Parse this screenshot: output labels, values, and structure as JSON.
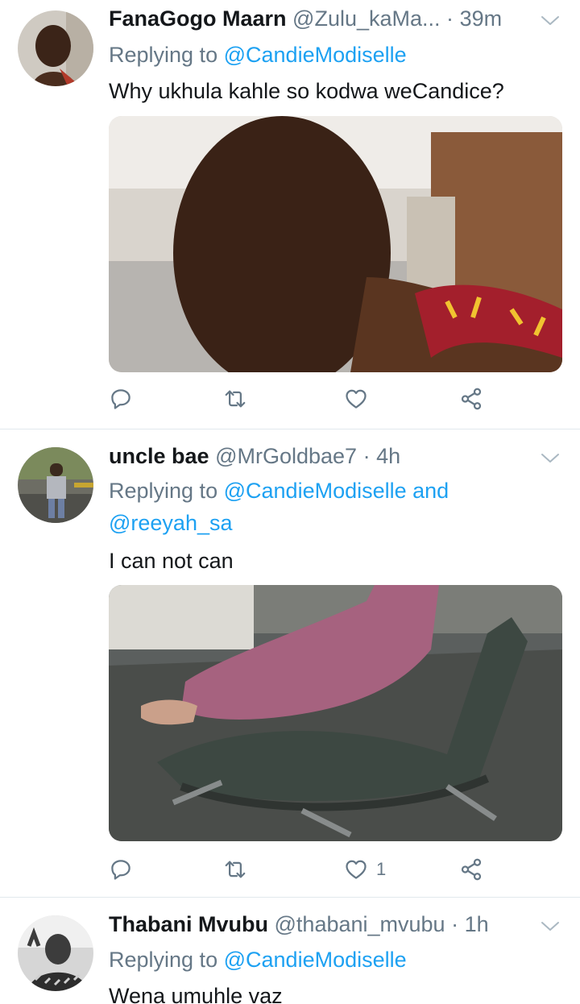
{
  "tweets": [
    {
      "name": "FanaGogo Maarn",
      "handle": "@Zulu_kaMa...",
      "time": "39m",
      "replying_label": "Replying to",
      "mentions": "@CandieModiselle",
      "extra": "",
      "text": "Why ukhula kahle so kodwa weCandice?",
      "like_count": ""
    },
    {
      "name": "uncle bae",
      "handle": "@MrGoldbae7",
      "time": "4h",
      "replying_label": "Replying to",
      "mentions": "@CandieModiselle and",
      "extra": "@reeyah_sa",
      "text": "I can not can",
      "like_count": "1"
    },
    {
      "name": "Thabani Mvubu",
      "handle": "@thabani_mvubu",
      "time": "1h",
      "replying_label": "Replying to",
      "mentions": "@CandieModiselle",
      "extra": "",
      "text": "Wena umuhle vaz",
      "like_count": ""
    }
  ],
  "separator": "·",
  "icons": [
    "reply-icon",
    "retweet-icon",
    "like-icon",
    "share-icon",
    "chevron-down-icon"
  ],
  "colors": {
    "link": "#1da1f2",
    "muted": "#657786",
    "text": "#14171a",
    "divider": "#e1e8ed"
  }
}
